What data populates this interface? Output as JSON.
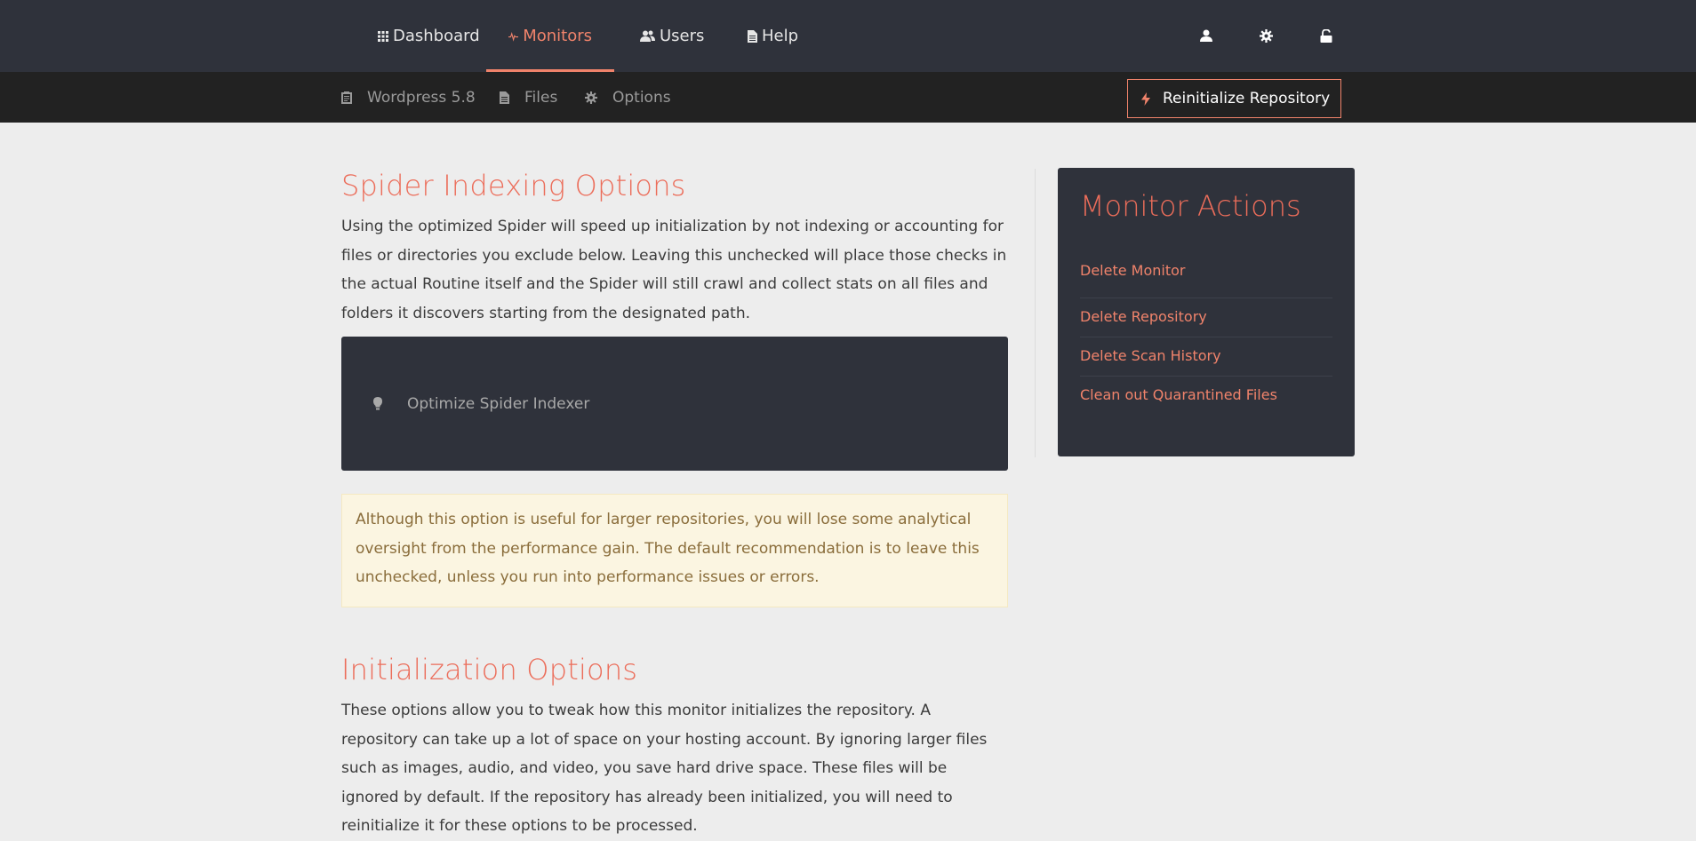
{
  "topnav": {
    "items": [
      {
        "label": "Dashboard",
        "icon": "grid-icon"
      },
      {
        "label": "Monitors",
        "icon": "pulse-icon",
        "active": true
      },
      {
        "label": "Users",
        "icon": "users-icon"
      },
      {
        "label": "Help",
        "icon": "document-icon"
      }
    ],
    "right_icons": [
      "user-icon",
      "gear-icon",
      "unlock-icon"
    ],
    "accent": "#f0836b"
  },
  "subnav": {
    "items": [
      {
        "label": "Wordpress 5.8",
        "icon": "clipboard-icon"
      },
      {
        "label": "Files",
        "icon": "file-icon"
      },
      {
        "label": "Options",
        "icon": "gear-icon"
      }
    ],
    "reinit_button": {
      "label": "Reinitialize Repository",
      "icon": "bolt-icon"
    }
  },
  "spider": {
    "title": "Spider Indexing Options",
    "description": "Using the optimized Spider will speed up initialization by not indexing or accounting for files or directories you exclude below. Leaving this unchecked will place those checks in the actual Routine itself and the Spider will still crawl and collect stats on all files and folders it discovers starting from the designated path.",
    "toggle_label": "Optimize Spider Indexer",
    "toggle_icon": "lightbulb-icon",
    "warning": "Although this option is useful for larger repositories, you will lose some analytical oversight from the performance gain. The default recommendation is to leave this unchecked, unless you run into performance issues or errors."
  },
  "init": {
    "title": "Initialization Options",
    "description": "These options allow you to tweak how this monitor initializes the repository. A repository can take up a lot of space on your hosting account. By ignoring larger files such as images, audio, and video, you save hard drive space. These files will be ignored by default. If the repository has already been initialized, you will need to reinitialize it for these options to be processed."
  },
  "sidebar": {
    "title": "Monitor Actions",
    "actions": [
      "Delete Monitor",
      "Delete Repository",
      "Delete Scan History",
      "Clean out Quarantined Files"
    ]
  }
}
